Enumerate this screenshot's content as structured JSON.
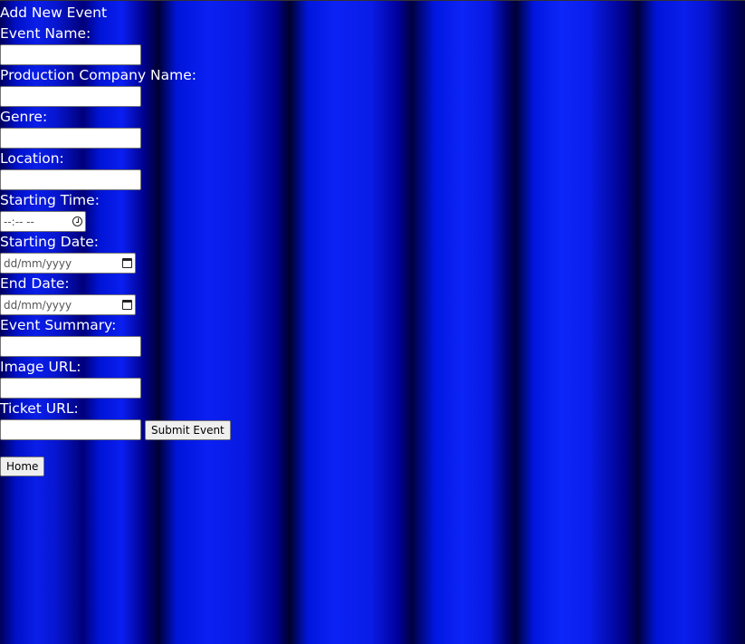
{
  "background": {
    "description_colors": [
      "#0a1ee8",
      "#00007a"
    ]
  },
  "form": {
    "title": "Add New Event",
    "fields": {
      "event_name": {
        "label": "Event Name:",
        "value": ""
      },
      "production_company": {
        "label": "Production Company Name:",
        "value": ""
      },
      "genre": {
        "label": "Genre:",
        "value": ""
      },
      "location": {
        "label": "Location:",
        "value": ""
      },
      "starting_time": {
        "label": "Starting Time:",
        "placeholder": "--:-- --",
        "icon": "clock-icon"
      },
      "starting_date": {
        "label": "Starting Date:",
        "placeholder": "dd/mm/yyyy",
        "icon": "calendar-icon"
      },
      "end_date": {
        "label": "End Date:",
        "placeholder": "dd/mm/yyyy",
        "icon": "calendar-icon"
      },
      "event_summary": {
        "label": "Event Summary:",
        "value": ""
      },
      "image_url": {
        "label": "Image URL:",
        "value": ""
      },
      "ticket_url": {
        "label": "Ticket URL:",
        "value": ""
      }
    },
    "submit_label": "Submit Event"
  },
  "nav": {
    "home_label": "Home"
  }
}
